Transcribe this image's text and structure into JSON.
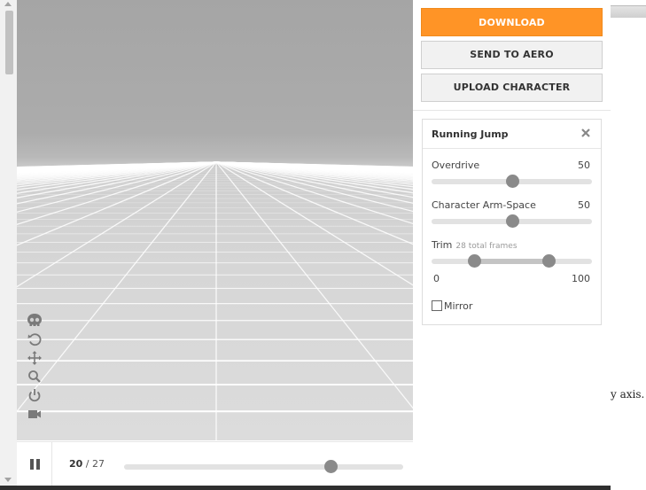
{
  "viewport": {
    "tools": [
      {
        "icon": "skull-icon"
      },
      {
        "icon": "reset-icon"
      },
      {
        "icon": "move-icon"
      },
      {
        "icon": "zoom-icon"
      },
      {
        "icon": "power-icon"
      },
      {
        "icon": "camera-icon"
      }
    ]
  },
  "playback": {
    "current_frame": "20",
    "separator": " / ",
    "total_frames": "27",
    "progress": 0.74
  },
  "actions": {
    "download_label": "DOWNLOAD",
    "send_to_aero_label": "SEND TO AERO",
    "upload_character_label": "UPLOAD CHARACTER",
    "accent_color": "#ff9426"
  },
  "animation_panel": {
    "title": "Running Jump",
    "overdrive": {
      "label": "Overdrive",
      "value": "50",
      "fraction": 0.5
    },
    "arm_space": {
      "label": "Character Arm-Space",
      "value": "50",
      "fraction": 0.5
    },
    "trim": {
      "label": "Trim",
      "sublabel": "28 total frames",
      "min_label": "0",
      "max_label": "100",
      "start_fraction": 0.265,
      "end_fraction": 0.73
    },
    "mirror": {
      "label": "Mirror",
      "checked": false
    }
  },
  "background_page": {
    "visible_text": "y axis."
  }
}
